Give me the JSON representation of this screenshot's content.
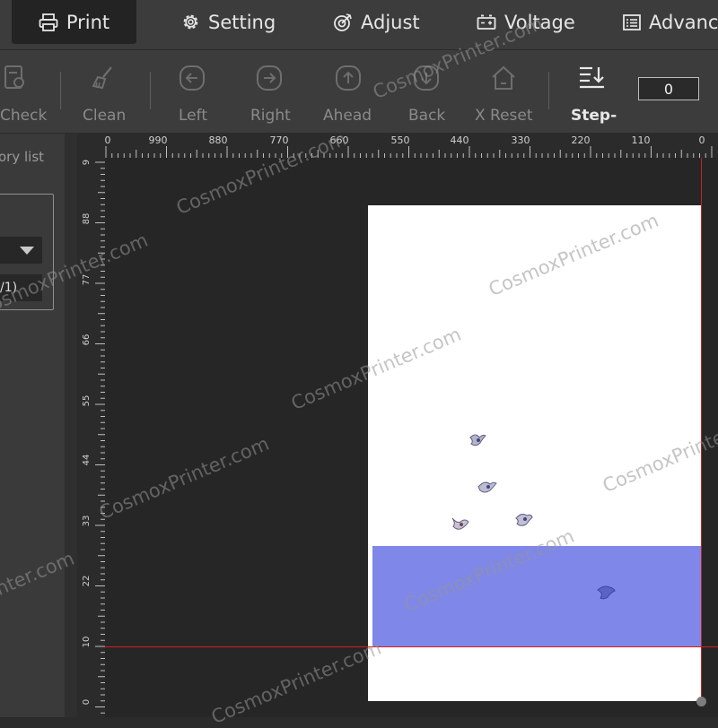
{
  "menu": {
    "tabs": [
      {
        "label": "Print"
      },
      {
        "label": "Setting"
      },
      {
        "label": "Adjust"
      },
      {
        "label": "Voltage"
      },
      {
        "label": "Advanc"
      }
    ]
  },
  "toolbar": {
    "buttons": [
      {
        "label": "Check"
      },
      {
        "label": "Clean"
      },
      {
        "label": "Left"
      },
      {
        "label": "Right"
      },
      {
        "label": "Ahead"
      },
      {
        "label": "Back"
      },
      {
        "label": "X Reset"
      },
      {
        "label": "Step-"
      }
    ],
    "step_value": "0"
  },
  "sidebar": {
    "history_label": "ory list",
    "page_indicator": "/1)"
  },
  "ruler": {
    "top_labels": [
      "0",
      "990",
      "880",
      "770",
      "660",
      "550",
      "440",
      "330",
      "220",
      "110",
      "0"
    ],
    "left_labels": [
      "9",
      "88",
      "77",
      "66",
      "55",
      "44",
      "33",
      "22",
      "10",
      "0"
    ]
  },
  "watermark": "CosmoxPrinter.com",
  "colors": {
    "menubar": "#3c3c3c",
    "canvas": "#262626",
    "print_block": "#7f87e8",
    "guide": "#d02020"
  }
}
